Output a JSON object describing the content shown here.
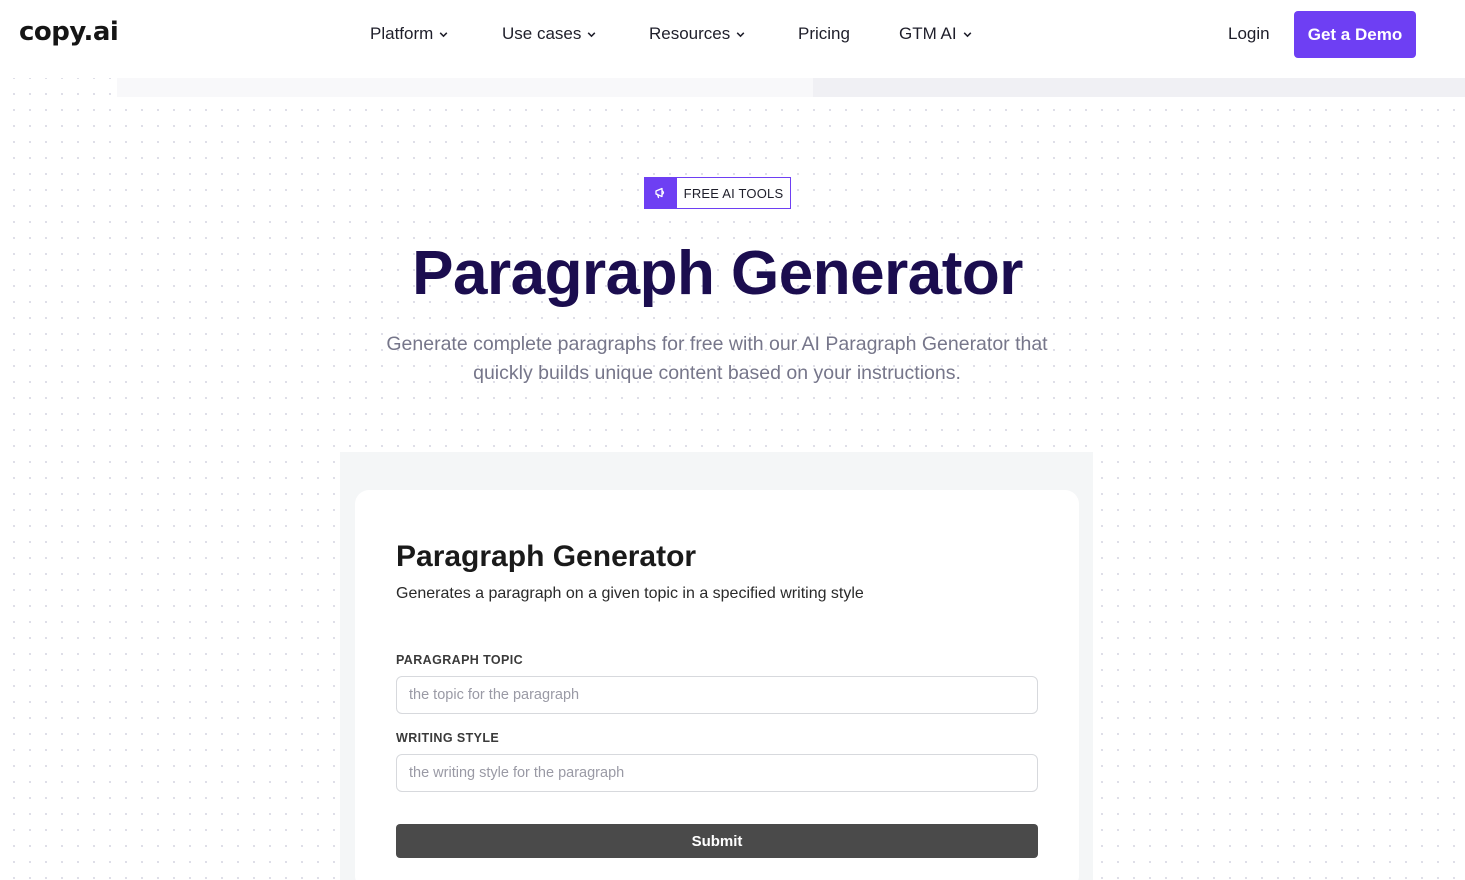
{
  "header": {
    "logo": "copy.ai",
    "nav": [
      {
        "label": "Platform",
        "dropdown": true
      },
      {
        "label": "Use cases",
        "dropdown": true
      },
      {
        "label": "Resources",
        "dropdown": true
      },
      {
        "label": "Pricing",
        "dropdown": false
      },
      {
        "label": "GTM AI",
        "dropdown": true
      }
    ],
    "login_label": "Login",
    "demo_label": "Get a Demo"
  },
  "hero": {
    "badge_icon": "megaphone-icon",
    "badge_text": "FREE AI TOOLS",
    "title": "Paragraph Generator",
    "subtitle": "Generate complete paragraphs for free with our AI Paragraph Generator that quickly builds unique content based on your instructions."
  },
  "tool": {
    "title": "Paragraph Generator",
    "description": "Generates a paragraph on a given topic in a specified writing style",
    "fields": [
      {
        "label": "PARAGRAPH TOPIC",
        "placeholder": "the topic for the paragraph",
        "value": ""
      },
      {
        "label": "WRITING STYLE",
        "placeholder": "the writing style for the paragraph",
        "value": ""
      }
    ],
    "submit_label": "Submit"
  },
  "colors": {
    "accent": "#6e3ff3",
    "title": "#1b0d4f",
    "submit": "#4a4a4a"
  }
}
